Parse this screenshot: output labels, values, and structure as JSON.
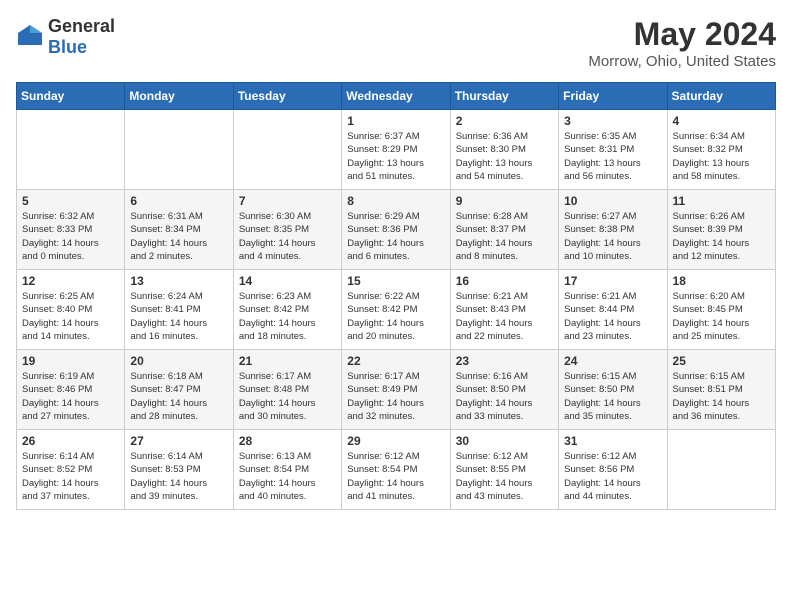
{
  "header": {
    "logo_general": "General",
    "logo_blue": "Blue",
    "month": "May 2024",
    "location": "Morrow, Ohio, United States"
  },
  "weekdays": [
    "Sunday",
    "Monday",
    "Tuesday",
    "Wednesday",
    "Thursday",
    "Friday",
    "Saturday"
  ],
  "weeks": [
    [
      {
        "day": "",
        "info": ""
      },
      {
        "day": "",
        "info": ""
      },
      {
        "day": "",
        "info": ""
      },
      {
        "day": "1",
        "info": "Sunrise: 6:37 AM\nSunset: 8:29 PM\nDaylight: 13 hours\nand 51 minutes."
      },
      {
        "day": "2",
        "info": "Sunrise: 6:36 AM\nSunset: 8:30 PM\nDaylight: 13 hours\nand 54 minutes."
      },
      {
        "day": "3",
        "info": "Sunrise: 6:35 AM\nSunset: 8:31 PM\nDaylight: 13 hours\nand 56 minutes."
      },
      {
        "day": "4",
        "info": "Sunrise: 6:34 AM\nSunset: 8:32 PM\nDaylight: 13 hours\nand 58 minutes."
      }
    ],
    [
      {
        "day": "5",
        "info": "Sunrise: 6:32 AM\nSunset: 8:33 PM\nDaylight: 14 hours\nand 0 minutes."
      },
      {
        "day": "6",
        "info": "Sunrise: 6:31 AM\nSunset: 8:34 PM\nDaylight: 14 hours\nand 2 minutes."
      },
      {
        "day": "7",
        "info": "Sunrise: 6:30 AM\nSunset: 8:35 PM\nDaylight: 14 hours\nand 4 minutes."
      },
      {
        "day": "8",
        "info": "Sunrise: 6:29 AM\nSunset: 8:36 PM\nDaylight: 14 hours\nand 6 minutes."
      },
      {
        "day": "9",
        "info": "Sunrise: 6:28 AM\nSunset: 8:37 PM\nDaylight: 14 hours\nand 8 minutes."
      },
      {
        "day": "10",
        "info": "Sunrise: 6:27 AM\nSunset: 8:38 PM\nDaylight: 14 hours\nand 10 minutes."
      },
      {
        "day": "11",
        "info": "Sunrise: 6:26 AM\nSunset: 8:39 PM\nDaylight: 14 hours\nand 12 minutes."
      }
    ],
    [
      {
        "day": "12",
        "info": "Sunrise: 6:25 AM\nSunset: 8:40 PM\nDaylight: 14 hours\nand 14 minutes."
      },
      {
        "day": "13",
        "info": "Sunrise: 6:24 AM\nSunset: 8:41 PM\nDaylight: 14 hours\nand 16 minutes."
      },
      {
        "day": "14",
        "info": "Sunrise: 6:23 AM\nSunset: 8:42 PM\nDaylight: 14 hours\nand 18 minutes."
      },
      {
        "day": "15",
        "info": "Sunrise: 6:22 AM\nSunset: 8:42 PM\nDaylight: 14 hours\nand 20 minutes."
      },
      {
        "day": "16",
        "info": "Sunrise: 6:21 AM\nSunset: 8:43 PM\nDaylight: 14 hours\nand 22 minutes."
      },
      {
        "day": "17",
        "info": "Sunrise: 6:21 AM\nSunset: 8:44 PM\nDaylight: 14 hours\nand 23 minutes."
      },
      {
        "day": "18",
        "info": "Sunrise: 6:20 AM\nSunset: 8:45 PM\nDaylight: 14 hours\nand 25 minutes."
      }
    ],
    [
      {
        "day": "19",
        "info": "Sunrise: 6:19 AM\nSunset: 8:46 PM\nDaylight: 14 hours\nand 27 minutes."
      },
      {
        "day": "20",
        "info": "Sunrise: 6:18 AM\nSunset: 8:47 PM\nDaylight: 14 hours\nand 28 minutes."
      },
      {
        "day": "21",
        "info": "Sunrise: 6:17 AM\nSunset: 8:48 PM\nDaylight: 14 hours\nand 30 minutes."
      },
      {
        "day": "22",
        "info": "Sunrise: 6:17 AM\nSunset: 8:49 PM\nDaylight: 14 hours\nand 32 minutes."
      },
      {
        "day": "23",
        "info": "Sunrise: 6:16 AM\nSunset: 8:50 PM\nDaylight: 14 hours\nand 33 minutes."
      },
      {
        "day": "24",
        "info": "Sunrise: 6:15 AM\nSunset: 8:50 PM\nDaylight: 14 hours\nand 35 minutes."
      },
      {
        "day": "25",
        "info": "Sunrise: 6:15 AM\nSunset: 8:51 PM\nDaylight: 14 hours\nand 36 minutes."
      }
    ],
    [
      {
        "day": "26",
        "info": "Sunrise: 6:14 AM\nSunset: 8:52 PM\nDaylight: 14 hours\nand 37 minutes."
      },
      {
        "day": "27",
        "info": "Sunrise: 6:14 AM\nSunset: 8:53 PM\nDaylight: 14 hours\nand 39 minutes."
      },
      {
        "day": "28",
        "info": "Sunrise: 6:13 AM\nSunset: 8:54 PM\nDaylight: 14 hours\nand 40 minutes."
      },
      {
        "day": "29",
        "info": "Sunrise: 6:12 AM\nSunset: 8:54 PM\nDaylight: 14 hours\nand 41 minutes."
      },
      {
        "day": "30",
        "info": "Sunrise: 6:12 AM\nSunset: 8:55 PM\nDaylight: 14 hours\nand 43 minutes."
      },
      {
        "day": "31",
        "info": "Sunrise: 6:12 AM\nSunset: 8:56 PM\nDaylight: 14 hours\nand 44 minutes."
      },
      {
        "day": "",
        "info": ""
      }
    ]
  ]
}
